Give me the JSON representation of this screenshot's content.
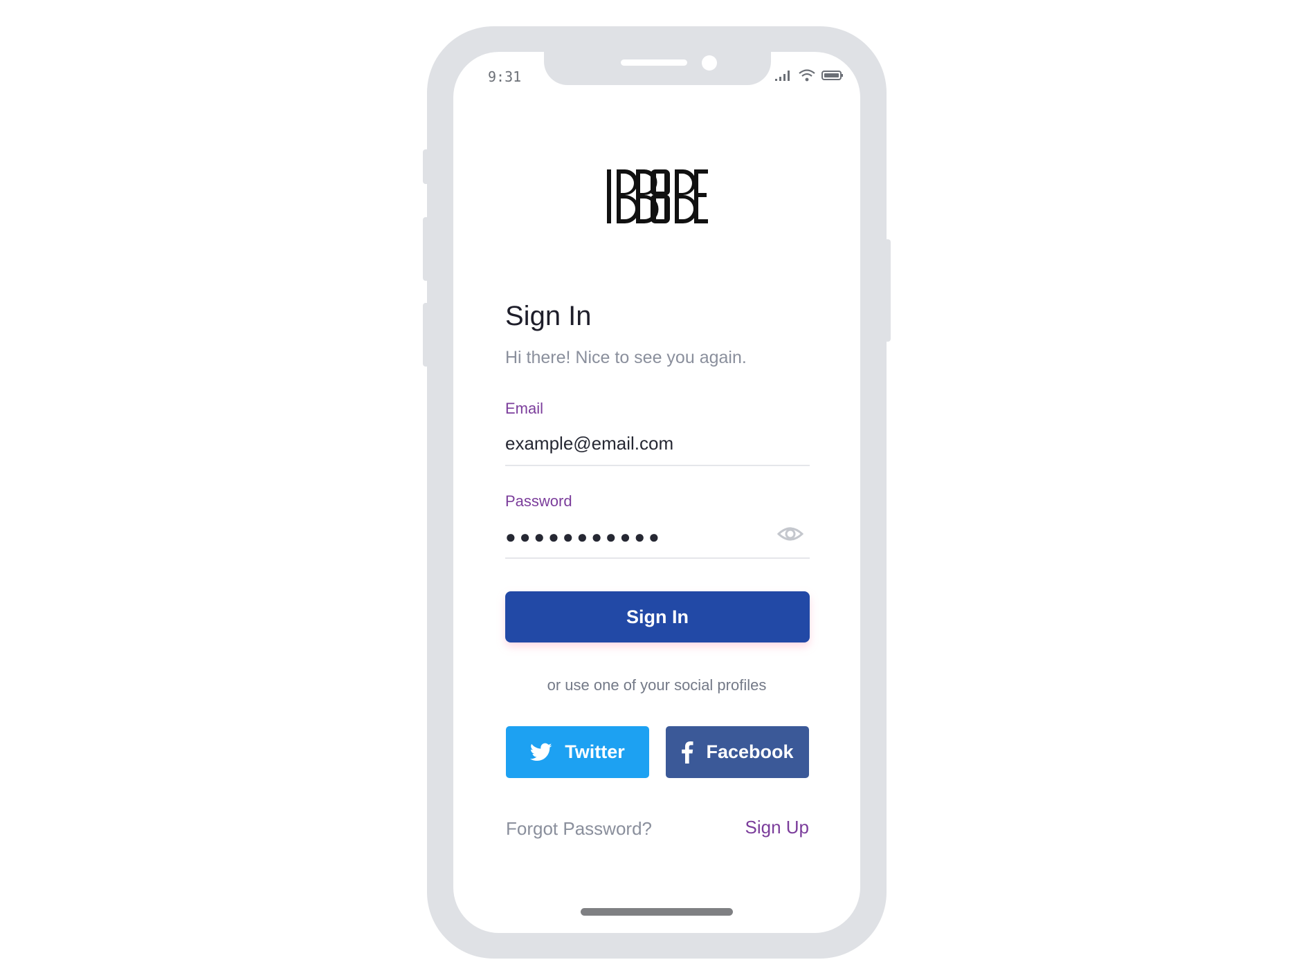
{
  "status_bar": {
    "time": "9:31"
  },
  "brand": {
    "logo_text": "IBB8BE"
  },
  "signin": {
    "title": "Sign In",
    "subtitle": "Hi there! Nice to see you again.",
    "email_label": "Email",
    "email_value": "example@email.com",
    "password_label": "Password",
    "password_masked": "●●●●●●●●●●●",
    "submit_label": "Sign In"
  },
  "social": {
    "prompt": "or use one of your social profiles",
    "twitter_label": "Twitter",
    "facebook_label": "Facebook"
  },
  "links": {
    "forgot_password": "Forgot Password?",
    "sign_up": "Sign Up"
  },
  "colors": {
    "primary": "#2249a6",
    "accent": "#7b3d9b",
    "twitter": "#1da1f2",
    "facebook": "#3b5998"
  },
  "icons": [
    "signal-icon",
    "wifi-icon",
    "battery-icon",
    "eye-icon",
    "twitter-bird-icon",
    "facebook-f-icon"
  ]
}
